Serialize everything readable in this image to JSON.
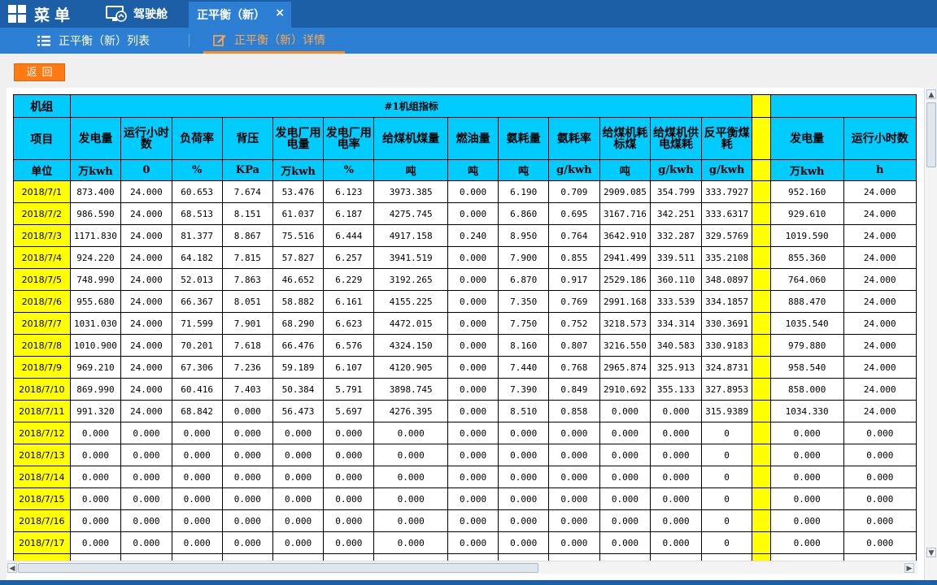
{
  "topbar": {
    "menu_label": "菜单",
    "cockpit_label": "驾驶舱",
    "active_tab": "正平衡（新）",
    "close_glyph": "×"
  },
  "subnav": {
    "list_label": "正平衡（新）列表",
    "detail_label": "正平衡（新）详情"
  },
  "back_label": "返回",
  "table": {
    "unit_group_label": "机组",
    "group_title": "#1机组指标",
    "item_label": "项目",
    "unit_row_label": "单位",
    "columns": [
      {
        "name": "发电量",
        "unit": "万kwh"
      },
      {
        "name": "运行小时数",
        "unit": "0"
      },
      {
        "name": "负荷率",
        "unit": "%"
      },
      {
        "name": "背压",
        "unit": "KPa"
      },
      {
        "name": "发电厂用电量",
        "unit": "万kwh"
      },
      {
        "name": "发电厂用电率",
        "unit": "%"
      },
      {
        "name": "给煤机煤量",
        "unit": "吨"
      },
      {
        "name": "燃油量",
        "unit": "吨"
      },
      {
        "name": "氨耗量",
        "unit": "吨"
      },
      {
        "name": "氨耗率",
        "unit": "g/kwh"
      },
      {
        "name": "给煤机耗标煤",
        "unit": "吨"
      },
      {
        "name": "给煤机供电煤耗",
        "unit": "g/kwh"
      },
      {
        "name": "反平衡煤耗",
        "unit": "g/kwh"
      }
    ],
    "columns2": [
      {
        "name": "发电量",
        "unit": "万kwh"
      },
      {
        "name": "运行小时数",
        "unit": "h"
      }
    ],
    "rows": [
      {
        "date": "2018/7/1",
        "v": [
          "873.400",
          "24.000",
          "60.653",
          "7.674",
          "53.476",
          "6.123",
          "3973.385",
          "0.000",
          "6.190",
          "0.709",
          "2909.085",
          "354.799",
          "333.7927"
        ],
        "v2": [
          "952.160",
          "24.000"
        ]
      },
      {
        "date": "2018/7/2",
        "v": [
          "986.590",
          "24.000",
          "68.513",
          "8.151",
          "61.037",
          "6.187",
          "4275.745",
          "0.000",
          "6.860",
          "0.695",
          "3167.716",
          "342.251",
          "333.6317"
        ],
        "v2": [
          "929.610",
          "24.000"
        ]
      },
      {
        "date": "2018/7/3",
        "v": [
          "1171.830",
          "24.000",
          "81.377",
          "8.867",
          "75.516",
          "6.444",
          "4917.158",
          "0.240",
          "8.950",
          "0.764",
          "3642.910",
          "332.287",
          "329.5769"
        ],
        "v2": [
          "1019.590",
          "24.000"
        ]
      },
      {
        "date": "2018/7/4",
        "v": [
          "924.220",
          "24.000",
          "64.182",
          "7.815",
          "57.827",
          "6.257",
          "3941.519",
          "0.000",
          "7.900",
          "0.855",
          "2941.499",
          "339.511",
          "335.2108"
        ],
        "v2": [
          "855.360",
          "24.000"
        ]
      },
      {
        "date": "2018/7/5",
        "v": [
          "748.990",
          "24.000",
          "52.013",
          "7.863",
          "46.652",
          "6.229",
          "3192.265",
          "0.000",
          "6.870",
          "0.917",
          "2529.186",
          "360.110",
          "348.0897"
        ],
        "v2": [
          "764.060",
          "24.000"
        ]
      },
      {
        "date": "2018/7/6",
        "v": [
          "955.680",
          "24.000",
          "66.367",
          "8.051",
          "58.882",
          "6.161",
          "4155.225",
          "0.000",
          "7.350",
          "0.769",
          "2991.168",
          "333.539",
          "334.1857"
        ],
        "v2": [
          "888.470",
          "24.000"
        ]
      },
      {
        "date": "2018/7/7",
        "v": [
          "1031.030",
          "24.000",
          "71.599",
          "7.901",
          "68.290",
          "6.623",
          "4472.015",
          "0.000",
          "7.750",
          "0.752",
          "3218.573",
          "334.314",
          "330.3691"
        ],
        "v2": [
          "1035.540",
          "24.000"
        ]
      },
      {
        "date": "2018/7/8",
        "v": [
          "1010.900",
          "24.000",
          "70.201",
          "7.618",
          "66.476",
          "6.576",
          "4324.150",
          "0.000",
          "8.160",
          "0.807",
          "3216.550",
          "340.583",
          "330.9183"
        ],
        "v2": [
          "979.880",
          "24.000"
        ]
      },
      {
        "date": "2018/7/9",
        "v": [
          "969.210",
          "24.000",
          "67.306",
          "7.236",
          "59.189",
          "6.107",
          "4120.905",
          "0.000",
          "7.440",
          "0.768",
          "2965.874",
          "325.913",
          "324.8731"
        ],
        "v2": [
          "958.540",
          "24.000"
        ]
      },
      {
        "date": "2018/7/10",
        "v": [
          "869.990",
          "24.000",
          "60.416",
          "7.403",
          "50.384",
          "5.791",
          "3898.745",
          "0.000",
          "7.390",
          "0.849",
          "2910.692",
          "355.133",
          "327.8953"
        ],
        "v2": [
          "858.000",
          "24.000"
        ]
      },
      {
        "date": "2018/7/11",
        "v": [
          "991.320",
          "24.000",
          "68.842",
          "0.000",
          "56.473",
          "5.697",
          "4276.395",
          "0.000",
          "8.510",
          "0.858",
          "0.000",
          "0.000",
          "315.9389"
        ],
        "v2": [
          "1034.330",
          "24.000"
        ]
      },
      {
        "date": "2018/7/12",
        "v": [
          "0.000",
          "0.000",
          "0.000",
          "0.000",
          "0.000",
          "0.000",
          "0.000",
          "0.000",
          "0.000",
          "0.000",
          "0.000",
          "0.000",
          "0"
        ],
        "v2": [
          "0.000",
          "0.000"
        ]
      },
      {
        "date": "2018/7/13",
        "v": [
          "0.000",
          "0.000",
          "0.000",
          "0.000",
          "0.000",
          "0.000",
          "0.000",
          "0.000",
          "0.000",
          "0.000",
          "0.000",
          "0.000",
          "0"
        ],
        "v2": [
          "0.000",
          "0.000"
        ]
      },
      {
        "date": "2018/7/14",
        "v": [
          "0.000",
          "0.000",
          "0.000",
          "0.000",
          "0.000",
          "0.000",
          "0.000",
          "0.000",
          "0.000",
          "0.000",
          "0.000",
          "0.000",
          "0"
        ],
        "v2": [
          "0.000",
          "0.000"
        ]
      },
      {
        "date": "2018/7/15",
        "v": [
          "0.000",
          "0.000",
          "0.000",
          "0.000",
          "0.000",
          "0.000",
          "0.000",
          "0.000",
          "0.000",
          "0.000",
          "0.000",
          "0.000",
          "0"
        ],
        "v2": [
          "0.000",
          "0.000"
        ]
      },
      {
        "date": "2018/7/16",
        "v": [
          "0.000",
          "0.000",
          "0.000",
          "0.000",
          "0.000",
          "0.000",
          "0.000",
          "0.000",
          "0.000",
          "0.000",
          "0.000",
          "0.000",
          "0"
        ],
        "v2": [
          "0.000",
          "0.000"
        ]
      },
      {
        "date": "2018/7/17",
        "v": [
          "0.000",
          "0.000",
          "0.000",
          "0.000",
          "0.000",
          "0.000",
          "0.000",
          "0.000",
          "0.000",
          "0.000",
          "0.000",
          "0.000",
          "0"
        ],
        "v2": [
          "0.000",
          "0.000"
        ]
      },
      {
        "date": "",
        "v": [
          "",
          "",
          "",
          "",
          "",
          "",
          "",
          "",
          "",
          "",
          "",
          "",
          ""
        ],
        "v2": [
          "",
          ""
        ]
      }
    ]
  },
  "colors": {
    "header_cyan": "#00ccff",
    "date_yellow": "#ffff00",
    "topbar_blue": "#1d5fa6",
    "accent_orange": "#ff7a12"
  }
}
